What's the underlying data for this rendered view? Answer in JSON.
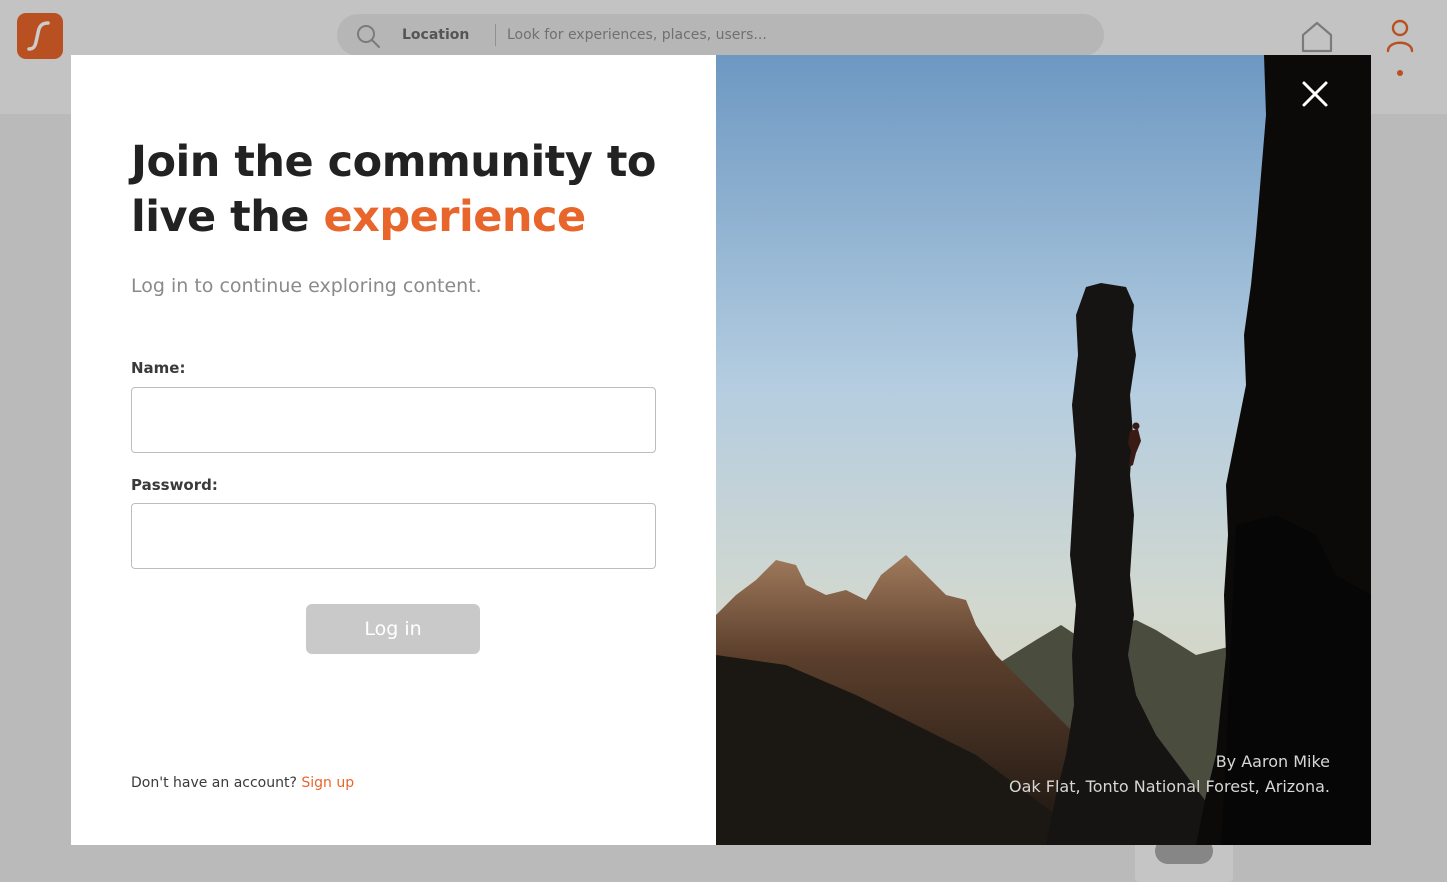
{
  "app": {
    "search": {
      "location_label": "Location",
      "placeholder": "Look for experiences, places, users..."
    }
  },
  "modal": {
    "title_prefix": "Join the community to live the ",
    "title_accent": "experience",
    "subtitle": "Log in to continue exploring content.",
    "fields": [
      {
        "label": "Name:",
        "value": ""
      },
      {
        "label": "Password:",
        "value": ""
      }
    ],
    "login_label": "Log in",
    "signup_prompt": "Don't have an account?",
    "signup_link": "Sign up",
    "photo_credit": {
      "author": "By Aaron Mike",
      "location": "Oak Flat, Tonto National Forest, Arizona."
    }
  },
  "colors": {
    "accent": "#e8652b",
    "text_dark": "#222222",
    "text_muted": "#8a8a8a",
    "button_disabled": "#c9c9c9"
  },
  "icons": [
    "logo-icon",
    "search-icon",
    "home-icon",
    "user-icon",
    "close-icon"
  ]
}
